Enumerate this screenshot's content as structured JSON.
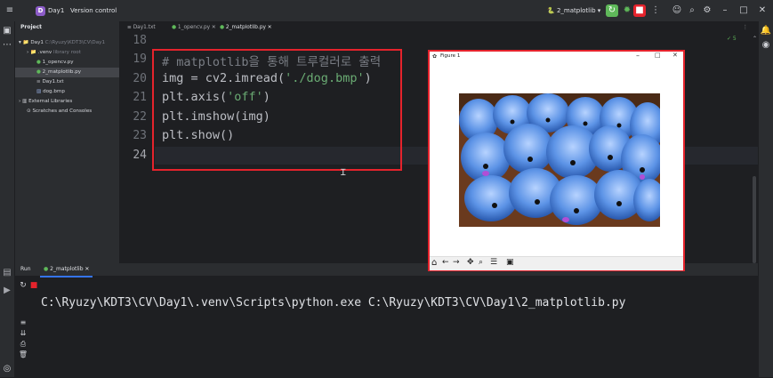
{
  "titlebar": {
    "project_initial": "D",
    "project_name": "Day1",
    "vcs_label": "Version control",
    "run_config": "2_matplotlib"
  },
  "project_panel": {
    "title": "Project",
    "items": [
      {
        "label": "Day1",
        "dim": "C:\\Ryuzy\\KDT3\\CV\\Day1"
      },
      {
        "label": ".venv",
        "dim": "library root"
      },
      {
        "label": "1_opencv.py",
        "dim": ""
      },
      {
        "label": "2_matplotlib.py",
        "dim": ""
      },
      {
        "label": "Day1.txt",
        "dim": ""
      },
      {
        "label": "dog.bmp",
        "dim": ""
      },
      {
        "label": "External Libraries",
        "dim": ""
      },
      {
        "label": "Scratches and Consoles",
        "dim": ""
      }
    ]
  },
  "tabs": [
    {
      "label": "Day1.txt"
    },
    {
      "label": "1_opencv.py"
    },
    {
      "label": "2_matplotlib.py"
    }
  ],
  "editor": {
    "inspection": "✓ 5",
    "lines": [
      {
        "num": "18",
        "text": ""
      },
      {
        "num": "19",
        "text": "# matplotlib을 통해 트루컬러로 출력"
      },
      {
        "num": "20",
        "pre": "img = cv2.imread(",
        "str": "'./dog.bmp'",
        "post": ")"
      },
      {
        "num": "21",
        "pre": "plt.axis(",
        "str": "'off'",
        "post": ")"
      },
      {
        "num": "22",
        "pre": "plt.imshow(img)",
        "str": "",
        "post": ""
      },
      {
        "num": "23",
        "pre": "plt.show()",
        "str": "",
        "post": ""
      },
      {
        "num": "24",
        "pre": "",
        "str": "",
        "post": ""
      }
    ]
  },
  "figure": {
    "title": "Figure 1",
    "image_description_icon": "blue-puppies-image"
  },
  "run": {
    "label": "Run",
    "tab": "2_matplotlib",
    "command": "C:\\Ryuzy\\KDT3\\CV\\Day1\\.venv\\Scripts\\python.exe C:\\Ryuzy\\KDT3\\CV\\Day1\\2_matplotlib.py"
  },
  "colors": {
    "highlight_box": "#e5232c",
    "accent_green": "#5fb85a"
  }
}
